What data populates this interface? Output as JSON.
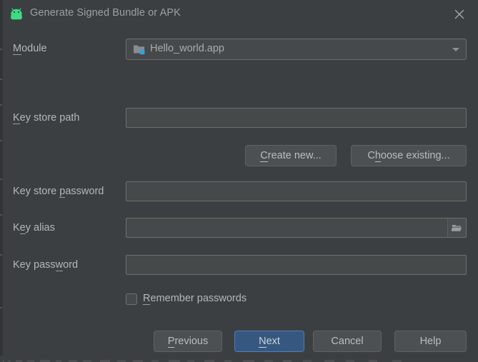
{
  "window": {
    "title": "Generate Signed Bundle or APK",
    "app_icon": "android-robot-icon",
    "close_icon": "close-icon",
    "background_color": "#3C3F41",
    "title_color": "#9DA0A3",
    "accent_color": "#365880",
    "android_green": "#3DDC84"
  },
  "form": {
    "module": {
      "label": "Module",
      "label_mnemonic": "M",
      "label_rest": "odule",
      "value": "Hello_world.app",
      "icon": "module-folder-icon",
      "dropdown_icon": "chevron-down-icon"
    },
    "key_store_path": {
      "label_mnemonic": "K",
      "label_rest": "ey store path",
      "value": "",
      "placeholder": ""
    },
    "key_store_password": {
      "label_prefix": "Key store ",
      "label_mnemonic": "p",
      "label_rest": "assword",
      "value": "",
      "placeholder": ""
    },
    "key_alias": {
      "label_prefix": "K",
      "label_mnemonic": "e",
      "label_rest": "y alias",
      "value": "",
      "placeholder": "",
      "browse_icon": "folder-open-icon"
    },
    "key_password": {
      "label_prefix": "Key pass",
      "label_mnemonic": "w",
      "label_rest": "ord",
      "value": "",
      "placeholder": ""
    },
    "remember_passwords": {
      "label_mnemonic": "R",
      "label_rest": "emember passwords",
      "checked": false
    }
  },
  "keystore_buttons": {
    "create_new": {
      "mnemonic": "C",
      "rest": "reate new..."
    },
    "choose_existing": {
      "prefix": "C",
      "mnemonic": "h",
      "rest": "oose existing..."
    }
  },
  "footer_buttons": {
    "previous": {
      "mnemonic": "P",
      "rest": "revious"
    },
    "next": {
      "mnemonic": "N",
      "rest": "ext",
      "primary": true
    },
    "cancel": {
      "label": "Cancel"
    },
    "help": {
      "label": "Help"
    }
  }
}
